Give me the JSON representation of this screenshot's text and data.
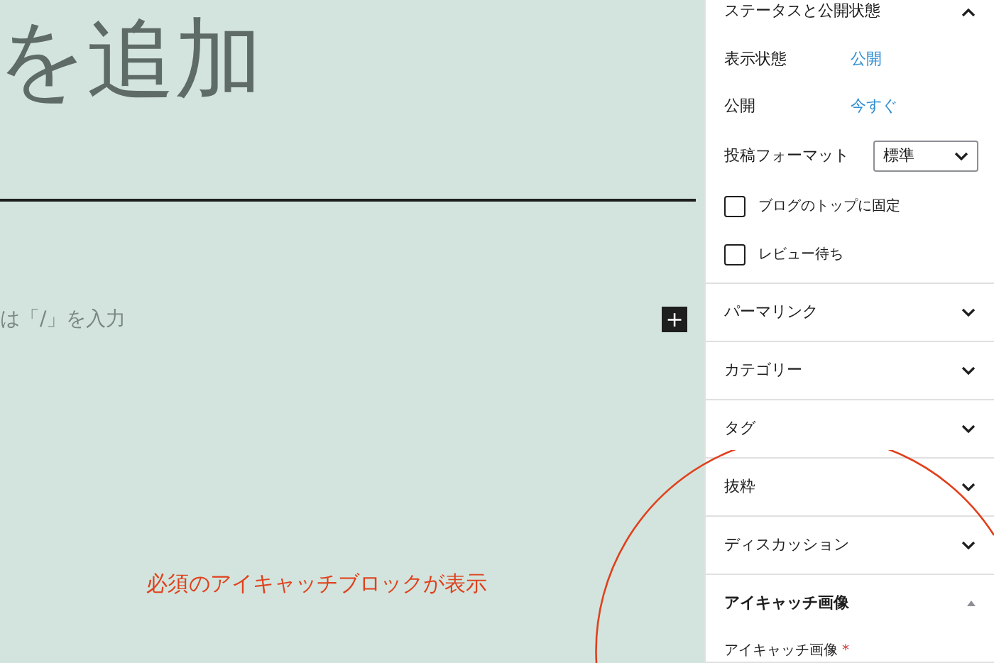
{
  "editor": {
    "title": "を追加",
    "placeholder": "は「/」を入力",
    "add_block_button": "+"
  },
  "sidebar": {
    "status_panel": {
      "title": "ステータスと公開状態",
      "expanded": true,
      "rows": [
        {
          "label": "表示状態",
          "value": "公開"
        },
        {
          "label": "公開",
          "value": "今すぐ"
        }
      ],
      "format": {
        "label": "投稿フォーマット",
        "value": "標準"
      },
      "checkboxes": [
        {
          "label": "ブログのトップに固定",
          "checked": false
        },
        {
          "label": "レビュー待ち",
          "checked": false
        }
      ]
    },
    "panels": [
      {
        "title": "パーマリンク",
        "expanded": false
      },
      {
        "title": "カテゴリー",
        "expanded": false
      },
      {
        "title": "タグ",
        "expanded": false
      },
      {
        "title": "抜粋",
        "expanded": false
      },
      {
        "title": "ディスカッション",
        "expanded": false
      },
      {
        "title": "アイキャッチ画像",
        "expanded": true,
        "field_label": "アイキャッチ画像",
        "required_mark": "*"
      }
    ]
  },
  "annotation": {
    "text": "必須のアイキャッチブロックが表示"
  }
}
